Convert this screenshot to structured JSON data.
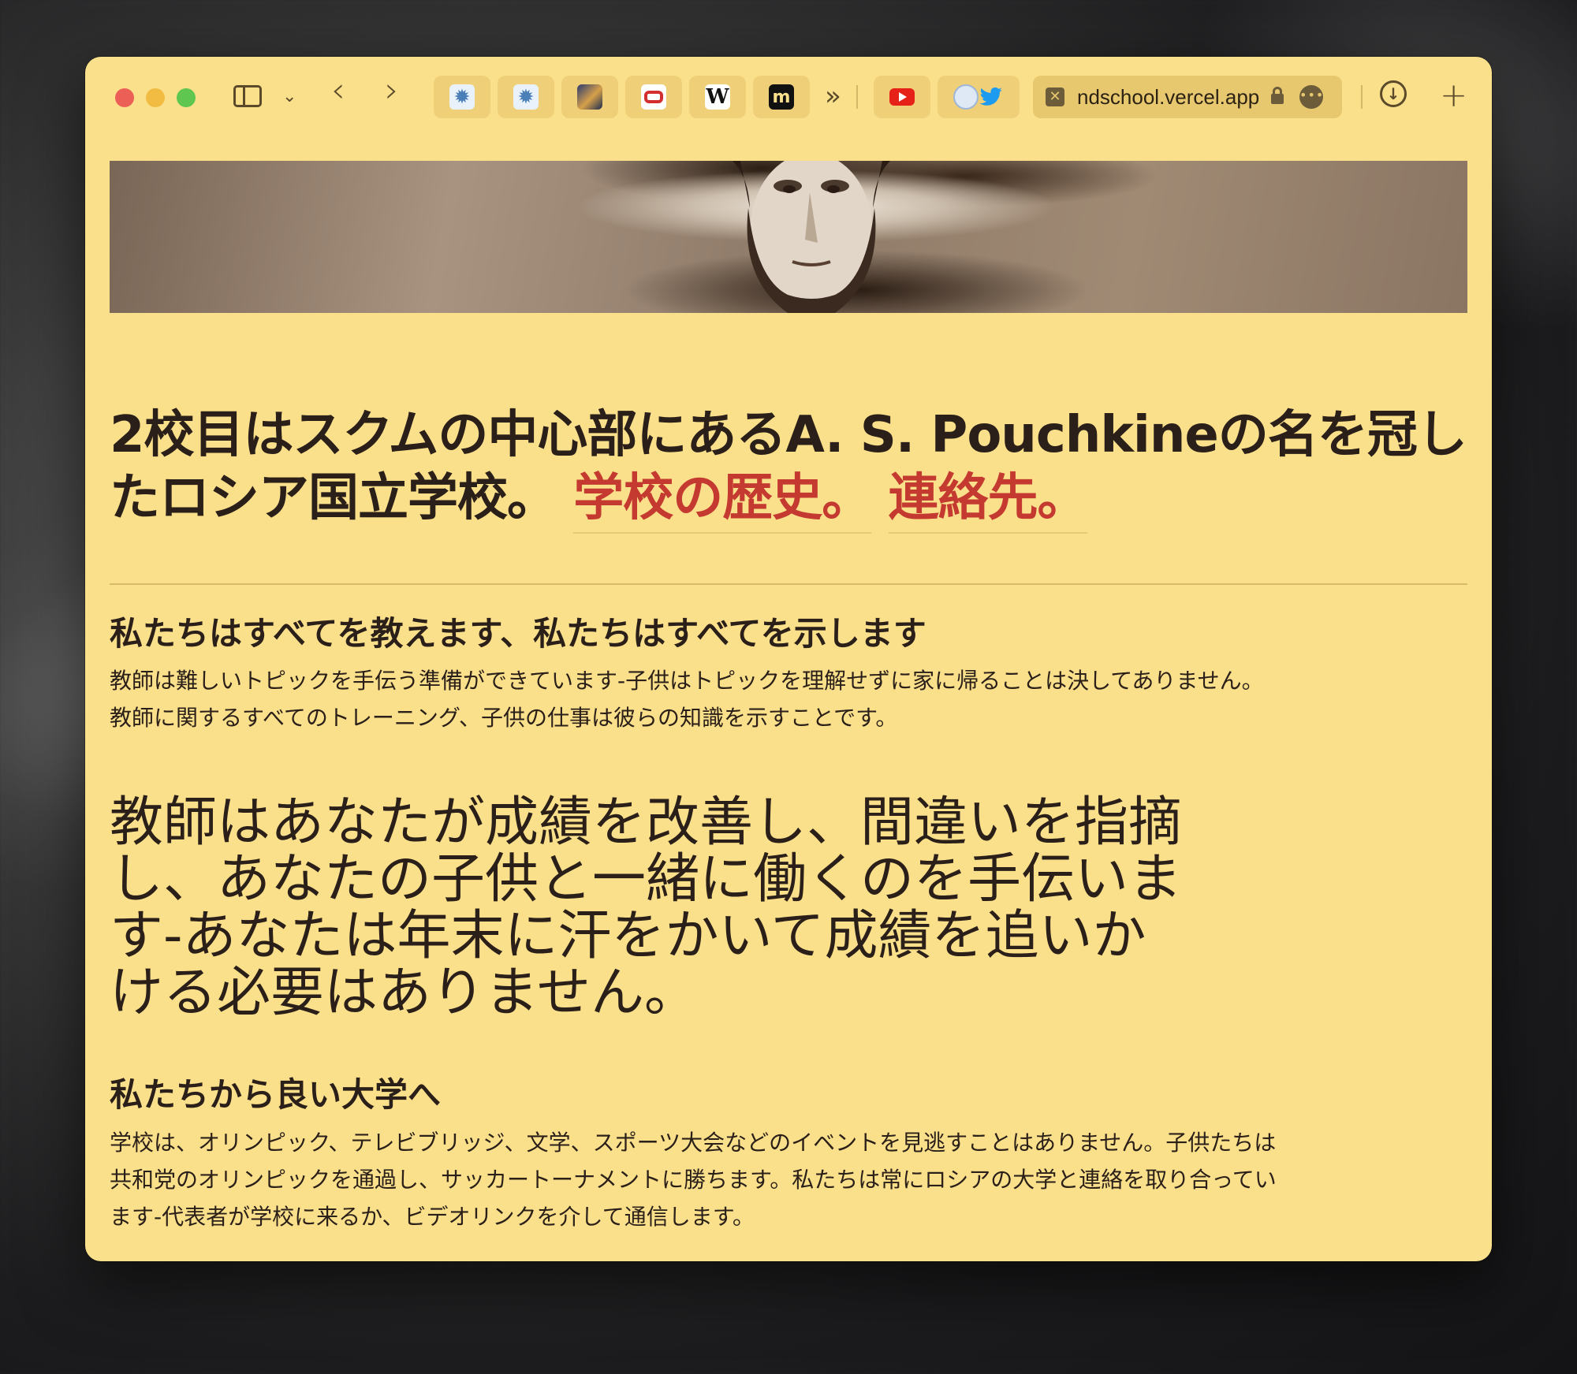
{
  "browser": {
    "url": "ndschool.vercel.app",
    "url_more": "•••",
    "download_glyph": "↓",
    "new_tab_glyph": "+",
    "back_glyph": "‹",
    "forward_glyph": "›",
    "more_tabs_glyph": "»",
    "sidebar_chevron_glyph": "⌄",
    "tabs": [
      {
        "icon": "gear-favicon",
        "glyph": "✹"
      },
      {
        "icon": "gear-favicon",
        "glyph": "✹"
      },
      {
        "icon": "image-favicon",
        "glyph": ""
      },
      {
        "icon": "red-rounded-favicon",
        "glyph": ""
      },
      {
        "icon": "wikipedia-favicon",
        "glyph": "W"
      },
      {
        "icon": "m-favicon",
        "glyph": "m"
      },
      {
        "icon": "youtube-favicon",
        "glyph": ""
      },
      {
        "icon": "circle-favicon",
        "glyph": ""
      },
      {
        "icon": "twitter-favicon",
        "glyph": "🐦"
      }
    ],
    "colors": {
      "page_bg": "#fbe08c",
      "link": "#c43a31",
      "text": "#2b2019"
    }
  },
  "page": {
    "headline": "2校目はスクムの中心部にあるA. S. Pouchkineの名を冠したロシア国立学校。",
    "link_history": "学校の歴史。",
    "link_contact": "連絡先。",
    "section1_title": "私たちはすべてを教えます、私たちはすべてを示します",
    "section1_text": "教師は難しいトピックを手伝う準備ができています-子供はトピックを理解せずに家に帰ることは決してありません。教師に関するすべてのトレーニング、子供の仕事は彼らの知識を示すことです。",
    "big_statement": "教師はあなたが成績を改善し、間違いを指摘し、あなたの子供と一緒に働くのを手伝います-あなたは年末に汗をかいて成績を追いかける必要はありません。",
    "section2_title": "私たちから良い大学へ",
    "section2_text": "学校は、オリンピック、テレビブリッジ、文学、スポーツ大会などのイベントを見逃すことはありません。子供たちは共和党のオリンピックを通過し、サッカートーナメントに勝ちます。私たちは常にロシアの大学と連絡を取り合っています-代表者が学校に来るか、ビデオリンクを介して通信します。"
  }
}
